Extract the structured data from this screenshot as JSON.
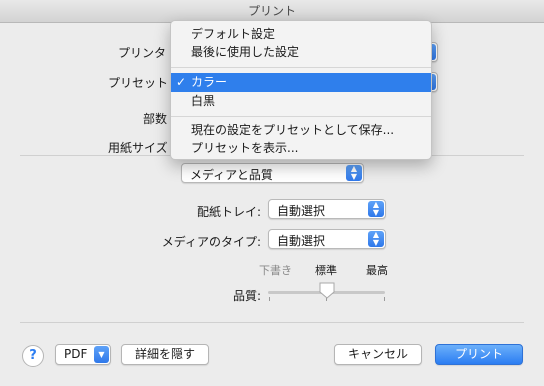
{
  "window": {
    "title": "プリント"
  },
  "form": {
    "printer_label": "プリンタ",
    "preset_label": "プリセット",
    "copies_label": "部数",
    "paper_size_label": "用紙サイズ"
  },
  "preset_menu": {
    "items": [
      "デフォルト設定",
      "最後に使用した設定"
    ],
    "selected": "カラー",
    "check": "✓",
    "item_bw": "白黒",
    "save_preset": "現在の設定をプリセットとして保存...",
    "show_presets": "プリセットを表示..."
  },
  "section_popup": {
    "value": "メディアと品質"
  },
  "media": {
    "tray_label": "配紙トレイ:",
    "tray_value": "自動選択",
    "type_label": "メディアのタイプ:",
    "type_value": "自動選択"
  },
  "quality": {
    "label": "品質:",
    "low": "下書き",
    "normal": "標準",
    "high": "最高",
    "level": 0.5
  },
  "footer": {
    "help": "?",
    "pdf": "PDF",
    "hide_details": "詳細を隠す",
    "cancel": "キャンセル",
    "print": "プリント"
  },
  "colors": {
    "accent": "#2f7fec"
  }
}
